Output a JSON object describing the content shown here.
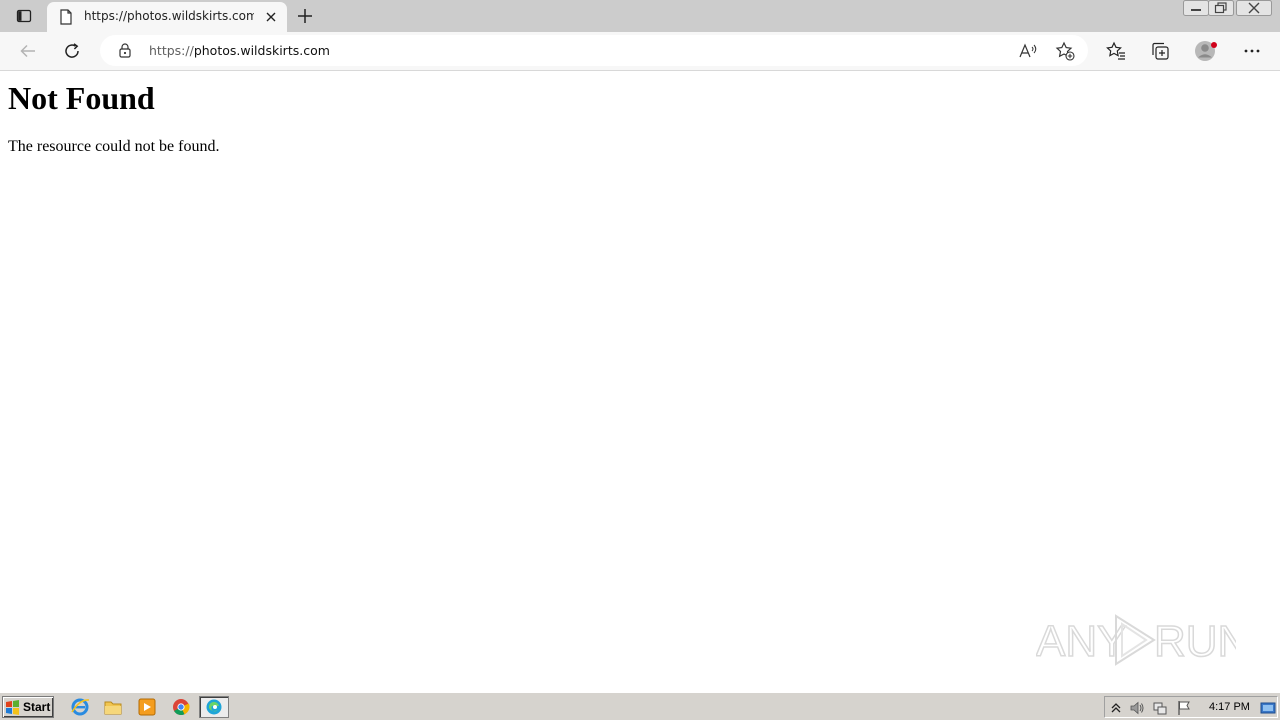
{
  "browser": {
    "tab": {
      "title": "https://photos.wildskirts.com"
    },
    "address_bar": {
      "scheme": "https://",
      "host": "photos.wildskirts.com"
    }
  },
  "page": {
    "heading": "Not Found",
    "message": "The resource could not be found."
  },
  "watermark": {
    "text": "ANY RUN"
  },
  "taskbar": {
    "start_label": "Start",
    "apps": [
      "internet-explorer-icon",
      "file-explorer-icon",
      "media-player-icon",
      "chrome-icon",
      "edge-icon"
    ],
    "active_app": "edge-icon",
    "clock": "4:17 PM"
  },
  "colors": {
    "tab_strip": "#cccccc",
    "toolbar": "#f7f7f7",
    "taskbar": "#d6d3ce",
    "profile_badge": "#d0021b"
  }
}
